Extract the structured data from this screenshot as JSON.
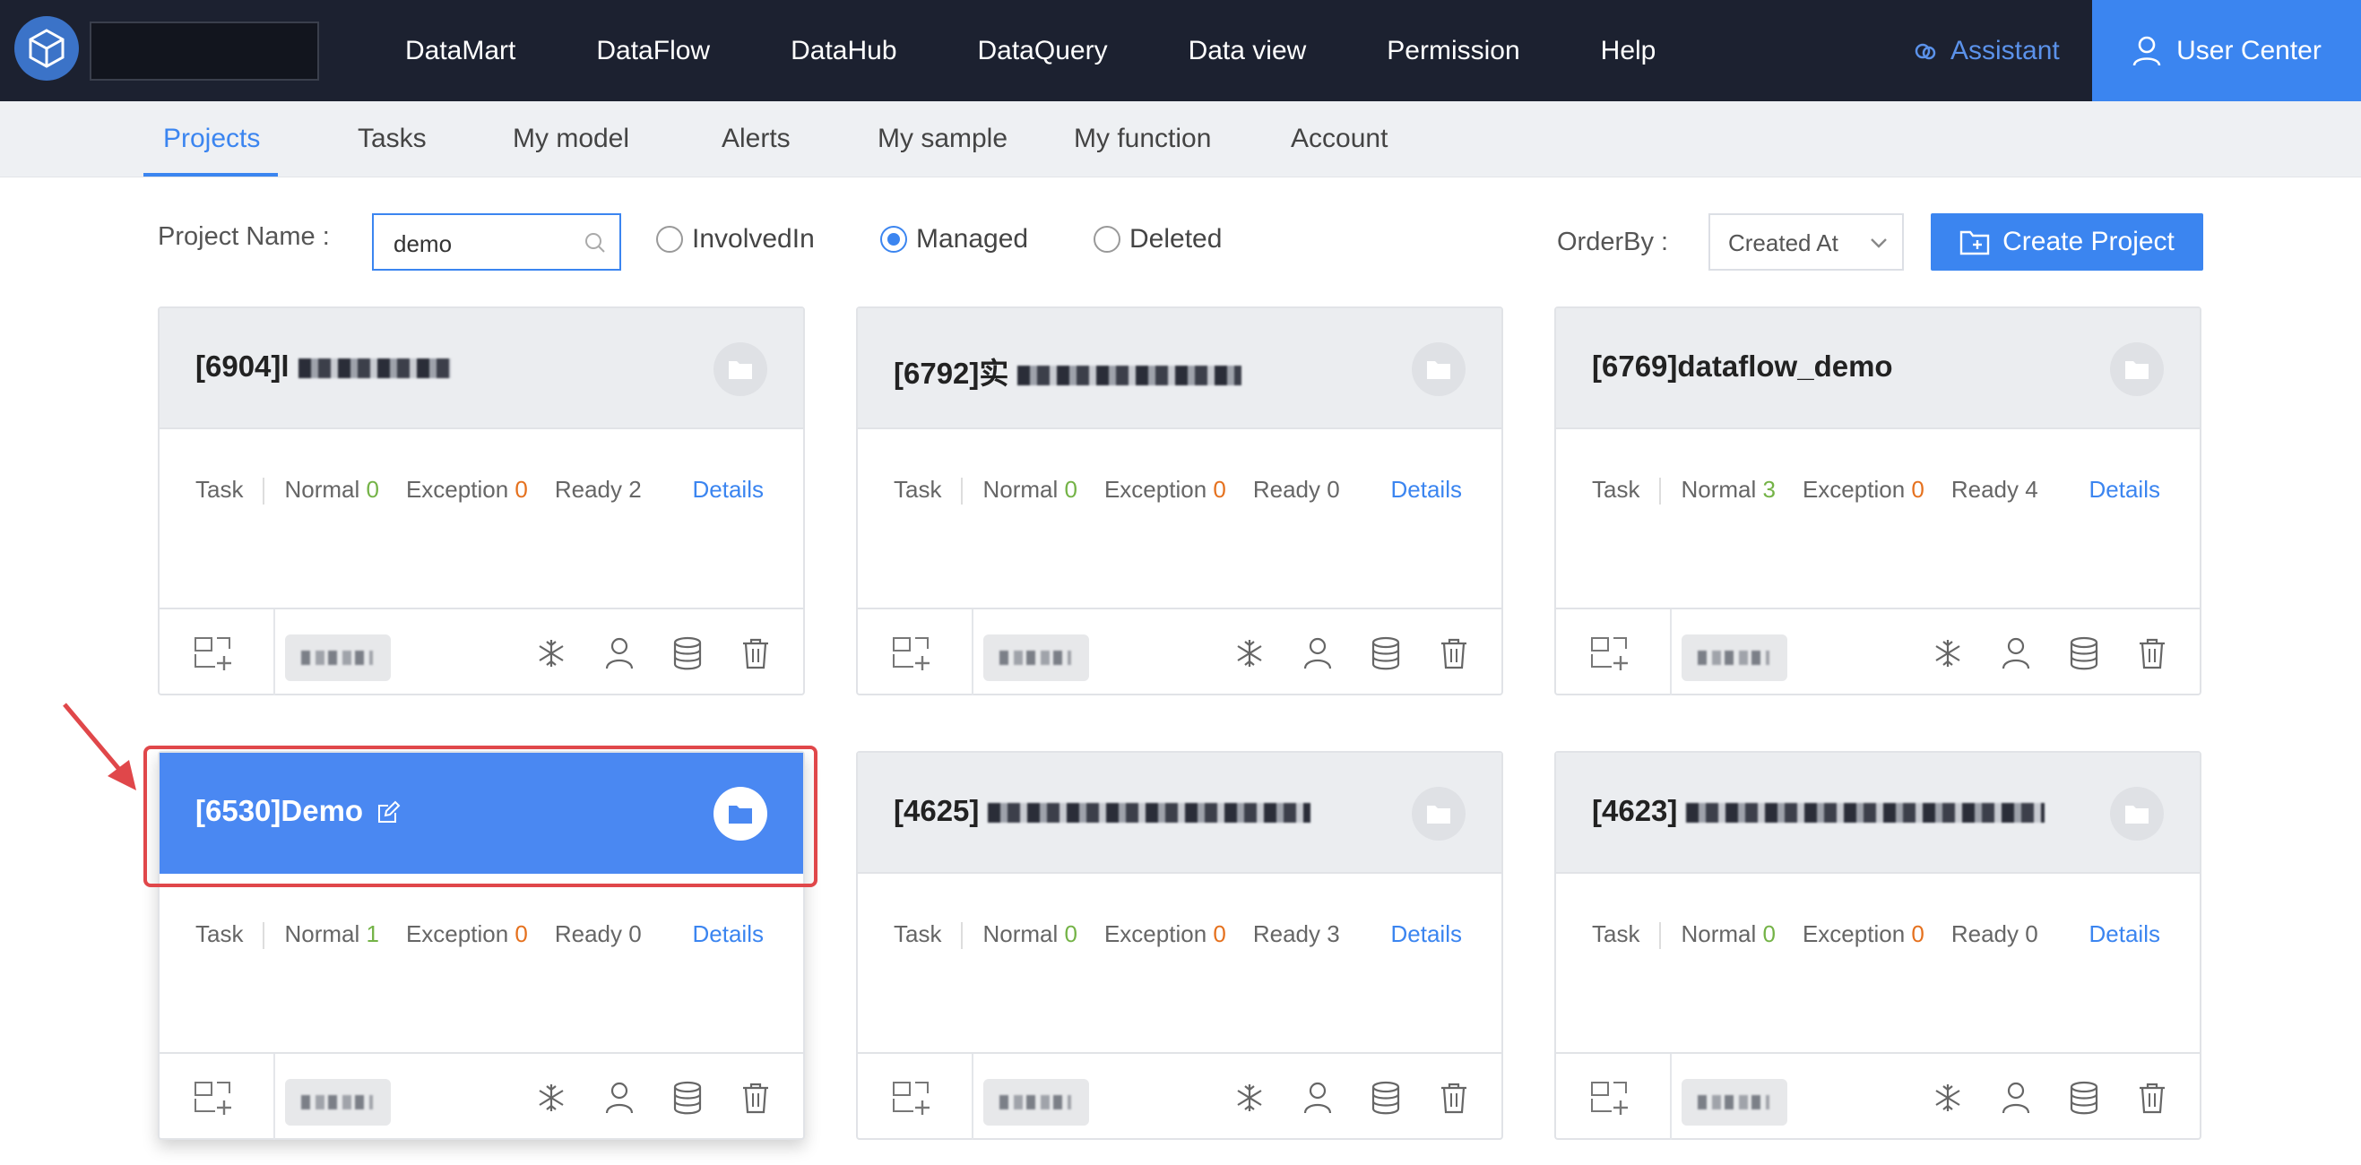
{
  "topnav": {
    "items": [
      {
        "label": "DataMart"
      },
      {
        "label": "DataFlow"
      },
      {
        "label": "DataHub"
      },
      {
        "label": "DataQuery"
      },
      {
        "label": "Data view"
      },
      {
        "label": "Permission"
      },
      {
        "label": "Help"
      }
    ],
    "assistant_label": "Assistant",
    "user_center_label": "User Center"
  },
  "subnav": {
    "tabs": [
      {
        "label": "Projects",
        "active": true
      },
      {
        "label": "Tasks"
      },
      {
        "label": "My model"
      },
      {
        "label": "Alerts"
      },
      {
        "label": "My sample"
      },
      {
        "label": "My function"
      },
      {
        "label": "Account"
      }
    ]
  },
  "filter": {
    "project_name_label": "Project Name :",
    "search_value": "demo",
    "radios": [
      {
        "label": "InvolvedIn",
        "checked": false
      },
      {
        "label": "Managed",
        "checked": true
      },
      {
        "label": "Deleted",
        "checked": false
      }
    ],
    "orderby_label": "OrderBy :",
    "orderby_value": "Created At",
    "create_label": "Create Project"
  },
  "card_labels": {
    "task": "Task",
    "normal": "Normal",
    "exception": "Exception",
    "ready": "Ready",
    "details": "Details"
  },
  "cards": [
    {
      "title": "[6904]l",
      "normal": "0",
      "exception": "0",
      "ready": "2"
    },
    {
      "title": "[6792]实",
      "normal": "0",
      "exception": "0",
      "ready": "0"
    },
    {
      "title": "[6769]dataflow_demo",
      "normal": "3",
      "exception": "0",
      "ready": "4"
    },
    {
      "title": "[6530]Demo",
      "normal": "1",
      "exception": "0",
      "ready": "0",
      "active": true
    },
    {
      "title": "[4625]",
      "normal": "0",
      "exception": "0",
      "ready": "3"
    },
    {
      "title": "[4623]",
      "normal": "0",
      "exception": "0",
      "ready": "0"
    }
  ],
  "colors": {
    "accent": "#3b85f0",
    "nav_bg": "#1c2130",
    "normal_count": "#74b347",
    "exception_count": "#e5711e",
    "annotation": "#e0474a"
  }
}
